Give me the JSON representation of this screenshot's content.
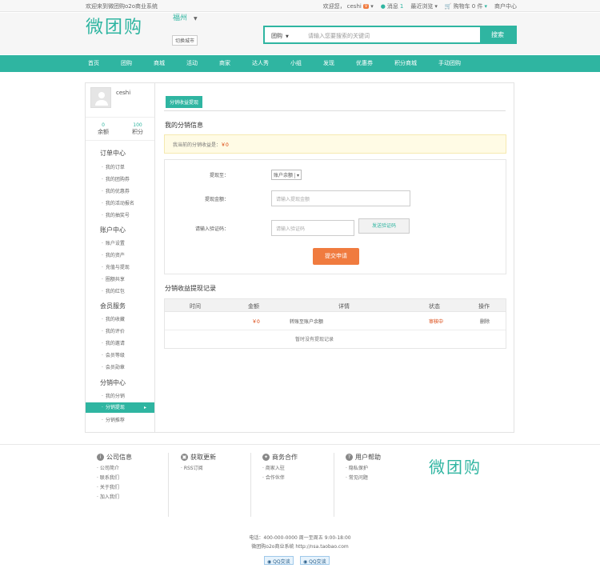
{
  "topbar": {
    "welcome": "欢迎来到微团购o2o商业系统",
    "greeting": "欢迎您，",
    "username": "ceshi",
    "message_label": "消息",
    "message_count": "1",
    "recent_browse": "最近浏览",
    "cart_label": "购物车 0 件",
    "merchant_center": "商户中心"
  },
  "header": {
    "logo": "微团购",
    "city": "福州",
    "switch_city": "切换城市",
    "search_category": "团购",
    "search_placeholder": "请输入您要搜索的关键词",
    "search_button": "搜索"
  },
  "nav": [
    "首页",
    "团购",
    "商城",
    "活动",
    "商家",
    "达人秀",
    "小组",
    "发现",
    "优惠券",
    "积分商城",
    "手动团购"
  ],
  "sidebar": {
    "username": "ceshi",
    "stats": [
      {
        "value": "0",
        "label": "余额"
      },
      {
        "value": "100",
        "label": "积分"
      }
    ],
    "sections": [
      {
        "title": "订单中心",
        "items": [
          "我的订单",
          "我的团购券",
          "我的优惠券",
          "我的活动报名",
          "我的抽奖号"
        ]
      },
      {
        "title": "账户中心",
        "items": [
          "账户设置",
          "我的资产",
          "充值与提现",
          "圈额共享",
          "我的红包"
        ]
      },
      {
        "title": "会员服务",
        "items": [
          "我的收藏",
          "我的评价",
          "我的邀请",
          "会员等级",
          "会员勋章"
        ]
      },
      {
        "title": "分销中心",
        "items": [
          "我的分销",
          "分销提现",
          "分销推荐"
        ]
      }
    ],
    "active_item": "分销提现"
  },
  "main": {
    "tab": "分销收益提现",
    "info_title": "我的分销信息",
    "notice_prefix": "我当前的分销收益是：",
    "notice_amount": "￥0",
    "form": {
      "method_label": "提现至：",
      "method_value": "账户余额",
      "amount_label": "提现金额：",
      "amount_placeholder": "请输入提现金额",
      "code_label": "请输入验证码：",
      "code_placeholder": "请输入验证码",
      "code_button": "发送验证码",
      "submit": "提交申请"
    },
    "records_title": "分销收益提现记录",
    "table": {
      "headers": [
        "时间",
        "金额",
        "详情",
        "状态",
        "操作"
      ],
      "row": [
        "",
        "￥0",
        "转账至账户余额",
        "审核中",
        "删除"
      ],
      "empty": "暂时没有提现记录"
    }
  },
  "footer": {
    "columns": [
      {
        "icon": "info-icon",
        "title": "公司信息",
        "links": [
          "公司简介",
          "联系我们",
          "关于我们",
          "加入我们"
        ]
      },
      {
        "icon": "rss-icon",
        "title": "获取更新",
        "links": [
          "RSS订阅"
        ]
      },
      {
        "icon": "handshake-icon",
        "title": "商务合作",
        "links": [
          "商家入驻",
          "合作伙伴"
        ]
      },
      {
        "icon": "help-icon",
        "title": "用户帮助",
        "links": [
          "隐私保护",
          "常见问题"
        ]
      }
    ],
    "logo": "微团购",
    "phone_line": "电话：400-000-0000 周一至周五 9:00-18:00",
    "site_line": "微团购o2o商业系统 http://nsa.taobao.com",
    "qq_buttons": [
      "QQ交谈",
      "QQ交谈"
    ]
  },
  "colors": {
    "accent": "#2fb5a1",
    "orange": "#f07b3f"
  }
}
